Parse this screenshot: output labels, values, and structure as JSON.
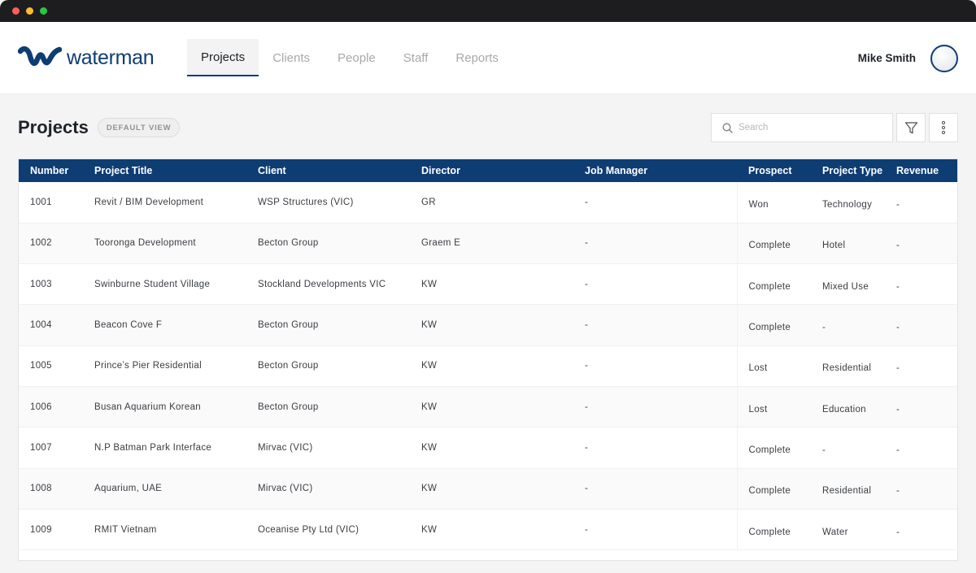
{
  "brand": {
    "name": "waterman",
    "color": "#0d3d73"
  },
  "nav": {
    "tabs": [
      {
        "label": "Projects",
        "active": true
      },
      {
        "label": "Clients",
        "active": false
      },
      {
        "label": "People",
        "active": false
      },
      {
        "label": "Staff",
        "active": false
      },
      {
        "label": "Reports",
        "active": false
      }
    ]
  },
  "user": {
    "name": "Mike Smith"
  },
  "page": {
    "title": "Projects",
    "view_badge": "DEFAULT VIEW",
    "search_placeholder": "Search"
  },
  "icons": {
    "search": "search-icon",
    "filter": "filter-icon",
    "more": "more-vertical-icon"
  },
  "table": {
    "columns": [
      "Number",
      "Project Title",
      "Client",
      "Director",
      "Job Manager",
      "Prospect",
      "Project Type",
      "Revenue"
    ],
    "rows": [
      {
        "number": "1001",
        "title": "Revit / BIM Development",
        "client": "WSP Structures (VIC)",
        "director": "GR",
        "job_manager": "-",
        "prospect": "Won",
        "type": "Technology",
        "revenue": "-"
      },
      {
        "number": "1002",
        "title": "Tooronga Development",
        "client": "Becton Group",
        "director": "Graem E",
        "job_manager": "-",
        "prospect": "Complete",
        "type": "Hotel",
        "revenue": "-"
      },
      {
        "number": "1003",
        "title": "Swinburne Student Village",
        "client": "Stockland Developments VIC",
        "director": "KW",
        "job_manager": "-",
        "prospect": "Complete",
        "type": "Mixed Use",
        "revenue": "-"
      },
      {
        "number": "1004",
        "title": "Beacon Cove F",
        "client": "Becton Group",
        "director": "KW",
        "job_manager": "-",
        "prospect": "Complete",
        "type": "-",
        "revenue": "-"
      },
      {
        "number": "1005",
        "title": "Prince’s Pier Residential",
        "client": "Becton Group",
        "director": "KW",
        "job_manager": "-",
        "prospect": "Lost",
        "type": "Residential",
        "revenue": "-"
      },
      {
        "number": "1006",
        "title": "Busan Aquarium Korean",
        "client": "Becton Group",
        "director": "KW",
        "job_manager": "-",
        "prospect": "Lost",
        "type": "Education",
        "revenue": "-"
      },
      {
        "number": "1007",
        "title": "N.P Batman Park Interface",
        "client": "Mirvac (VIC)",
        "director": "KW",
        "job_manager": "-",
        "prospect": "Complete",
        "type": "-",
        "revenue": "-"
      },
      {
        "number": "1008",
        "title": "Aquarium, UAE",
        "client": "Mirvac (VIC)",
        "director": "KW",
        "job_manager": "-",
        "prospect": "Complete",
        "type": "Residential",
        "revenue": "-"
      },
      {
        "number": "1009",
        "title": "RMIT Vietnam",
        "client": "Oceanise Pty Ltd (VIC)",
        "director": "KW",
        "job_manager": "-",
        "prospect": "Complete",
        "type": "Water",
        "revenue": "-"
      }
    ]
  }
}
